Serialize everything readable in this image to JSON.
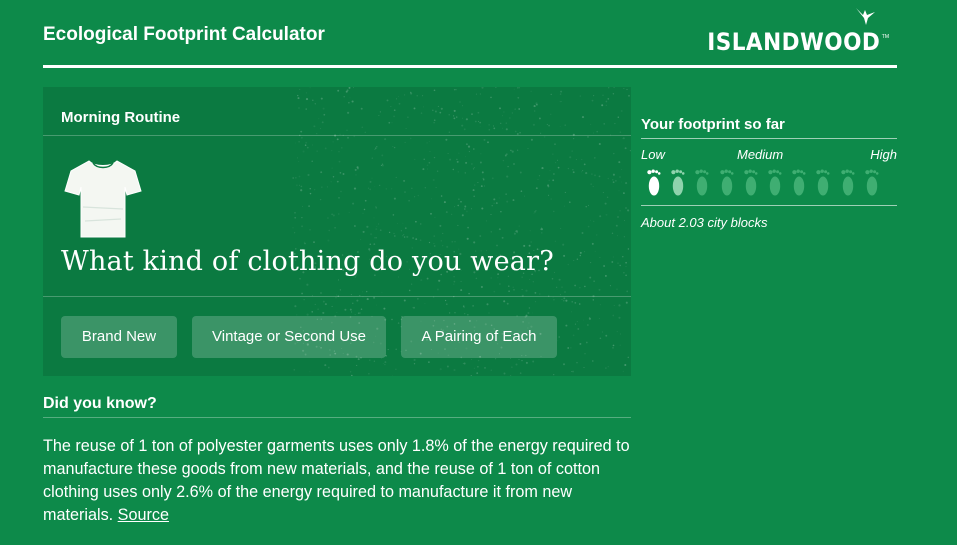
{
  "header": {
    "title": "Ecological Footprint Calculator",
    "logo_text": "ISLANDWOOD",
    "logo_tm": "TM"
  },
  "question_card": {
    "section": "Morning Routine",
    "icon": "t-shirt-icon",
    "question": "What kind of clothing do you wear?",
    "options": [
      "Brand New",
      "Vintage or Second Use",
      "A Pairing of Each"
    ]
  },
  "did_you_know": {
    "title": "Did you know?",
    "body": "The reuse of 1 ton of polyester garments uses only 1.8% of the energy required to manufacture these goods from new materials, and the reuse of 1 ton of cotton clothing uses only 2.6% of the energy required to manufacture it from new materials.",
    "link": "Source"
  },
  "footprint": {
    "title": "Your footprint so far",
    "scale": {
      "low": "Low",
      "medium": "Medium",
      "high": "High"
    },
    "total_feet": 10,
    "filled_feet": 1,
    "partial_feet": 1,
    "summary": "About 2.03 city blocks"
  },
  "colors": {
    "background": "#0d8a4a",
    "card": "#0b7a41",
    "foot_active": "#ffffff",
    "foot_partial": "#8fd3ad",
    "foot_inactive": "#3fae72"
  }
}
